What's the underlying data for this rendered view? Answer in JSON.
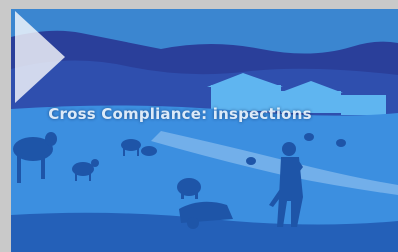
{
  "video": {
    "title": "Cross Compliance: inspections",
    "play_icon": "play-icon",
    "colors": {
      "sky": "#3b86d0",
      "hills": "#2a3f9a",
      "field": "#3c8fe0",
      "path": "#7fb6ec",
      "silhouette": "#1e55a8",
      "farmhouse": "#5fb5f0",
      "play": "#ffffff"
    }
  }
}
